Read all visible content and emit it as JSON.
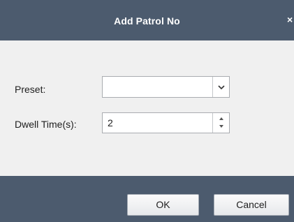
{
  "dialog": {
    "title": "Add Patrol No",
    "close_glyph": "×",
    "colors": {
      "titlebar": "#4c5b6e",
      "body": "#f0f0f0"
    }
  },
  "form": {
    "preset_label": "Preset:",
    "preset_value": "",
    "dwell_label": "Dwell Time(s):",
    "dwell_value": "2"
  },
  "buttons": {
    "ok_label": "OK",
    "cancel_label": "Cancel"
  },
  "icons": [
    "close-icon",
    "chevron-down-icon",
    "spin-up-icon",
    "spin-down-icon"
  ]
}
